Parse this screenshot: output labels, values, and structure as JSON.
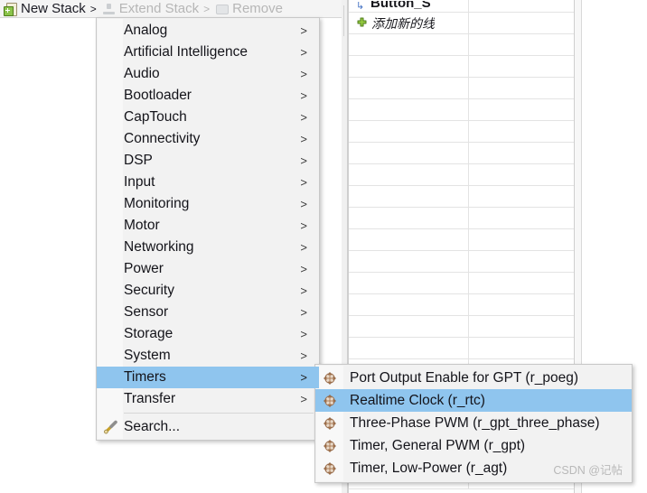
{
  "toolbar": {
    "new_stack": {
      "label": "New Stack",
      "caret": ">",
      "icon": "new-stack-icon",
      "enabled": true
    },
    "extend_stack": {
      "label": "Extend Stack",
      "caret": ">",
      "icon": "extend-stack-icon",
      "enabled": false
    },
    "remove": {
      "label": "Remove",
      "icon": "remove-icon",
      "enabled": false
    }
  },
  "tree": {
    "rows": [
      {
        "label": "Button_S",
        "icon": "expand-arrow-icon",
        "clipped": true,
        "italic": false
      },
      {
        "label": "添加新的线",
        "icon": "green-plus-icon",
        "clipped": true,
        "italic": true
      }
    ],
    "empty_row_count": 16
  },
  "menu": {
    "items": [
      {
        "label": "Analog",
        "has_submenu": true,
        "selected": false
      },
      {
        "label": "Artificial Intelligence",
        "has_submenu": true,
        "selected": false
      },
      {
        "label": "Audio",
        "has_submenu": true,
        "selected": false
      },
      {
        "label": "Bootloader",
        "has_submenu": true,
        "selected": false
      },
      {
        "label": "CapTouch",
        "has_submenu": true,
        "selected": false
      },
      {
        "label": "Connectivity",
        "has_submenu": true,
        "selected": false
      },
      {
        "label": "DSP",
        "has_submenu": true,
        "selected": false
      },
      {
        "label": "Input",
        "has_submenu": true,
        "selected": false
      },
      {
        "label": "Monitoring",
        "has_submenu": true,
        "selected": false
      },
      {
        "label": "Motor",
        "has_submenu": true,
        "selected": false
      },
      {
        "label": "Networking",
        "has_submenu": true,
        "selected": false
      },
      {
        "label": "Power",
        "has_submenu": true,
        "selected": false
      },
      {
        "label": "Security",
        "has_submenu": true,
        "selected": false
      },
      {
        "label": "Sensor",
        "has_submenu": true,
        "selected": false
      },
      {
        "label": "Storage",
        "has_submenu": true,
        "selected": false
      },
      {
        "label": "System",
        "has_submenu": true,
        "selected": false
      },
      {
        "label": "Timers",
        "has_submenu": true,
        "selected": true
      },
      {
        "label": "Transfer",
        "has_submenu": true,
        "selected": false
      }
    ],
    "submenu_arrow": ">",
    "search": {
      "label": "Search...",
      "icon": "search-pencil-icon"
    }
  },
  "submenu": {
    "title_parent": "Timers",
    "items": [
      {
        "label": "Port Output Enable for GPT (r_poeg)",
        "icon": "module-icon",
        "selected": false
      },
      {
        "label": "Realtime Clock (r_rtc)",
        "icon": "module-icon",
        "selected": true
      },
      {
        "label": "Three-Phase PWM (r_gpt_three_phase)",
        "icon": "module-icon",
        "selected": false
      },
      {
        "label": "Timer, General PWM (r_gpt)",
        "icon": "module-icon",
        "selected": false
      },
      {
        "label": "Timer, Low-Power (r_agt)",
        "icon": "module-icon",
        "selected": false
      }
    ]
  },
  "watermark": {
    "text": "CSDN @记帖"
  },
  "colors": {
    "menu_bg": "#f2f2f2",
    "menu_gutter": "#f8f8f8",
    "highlight": "#8fc5ee",
    "border": "#c8c8c8",
    "text": "#14141a",
    "disabled_text": "#b6b6b6",
    "grid_line": "#e3e3e3"
  }
}
